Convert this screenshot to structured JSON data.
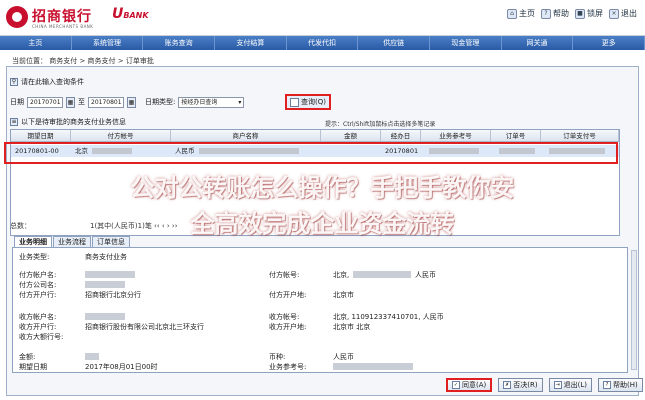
{
  "header": {
    "bank_name": "招商银行",
    "bank_name_en": "CHINA MERCHANTS BANK",
    "ubank": "U",
    "ubank_sub": "BANK",
    "links": [
      {
        "icon": "home-icon",
        "label": "主页"
      },
      {
        "icon": "help-icon",
        "label": "帮助"
      },
      {
        "icon": "lock-icon",
        "label": "锁屏"
      },
      {
        "icon": "exit-icon",
        "label": "退出"
      }
    ]
  },
  "nav": [
    "主页",
    "系统管理",
    "账务查询",
    "支付结算",
    "代发代扣",
    "供应链",
    "现金管理",
    "网关通",
    "更多"
  ],
  "breadcrumb": "当前位置： 商务支付 > 商务支付 > 订单审批",
  "query": {
    "hint": "请在此输入查询条件",
    "date_label": "日期",
    "date_from": "20170701",
    "date_to_label": "至",
    "date_to": "20170801",
    "date_type_label": "日期类型:",
    "date_type_value": "按经办日查询",
    "query_button": "查询(Q)"
  },
  "list": {
    "caption": "以下是待审批的商务支付业务信息",
    "hint": "提示：Ctrl/Shift加鼠标点击选择多笔记录",
    "columns": [
      "期望日期",
      "付方帐号",
      "商户名称",
      "金额",
      "经办日",
      "业务参考号",
      "订单号",
      "订单支付号"
    ],
    "row": {
      "date": "20170801-00",
      "payer": "北京",
      "currency": "人民币",
      "op_date": "20170801"
    },
    "footer": "总数：",
    "pager": "1(其中(人民币)1)笔   ‹‹   ‹   ›   ››"
  },
  "tabs": [
    "业务明细",
    "业务流程",
    "订单信息"
  ],
  "detail": {
    "business_type_label": "业务类型:",
    "business_type": "商务支付业务",
    "payer_account_label": "付方帐户名:",
    "payer_company_label": "付方公司名:",
    "payer_bank_label": "付方开户行:",
    "payer_bank": "招商银行北京分行",
    "payer_acct_no_label": "付方帐号:",
    "payer_acct_no_prefix": "北京,",
    "payer_currency": "人民币",
    "payer_open_place_label": "付方开户地:",
    "payer_open_place": "北京市",
    "payee_account_label": "收方帐户名:",
    "payee_bank_label": "收方开户行:",
    "payee_bank": "招商银行股份有限公司北京北三环支行",
    "payee_bank_no_label": "收方大额行号:",
    "payee_acct_no_label": "收方帐号:",
    "payee_acct_no": "北京, 110912337410701, 人民币",
    "payee_open_place_label": "收方开户地:",
    "payee_open_place": "北京市 北京",
    "amount_label": "金额:",
    "expect_date_label": "期望日期",
    "expect_date": "2017年08月01日00时",
    "currency_label": "币种:",
    "currency": "人民币",
    "ref_label": "业务参考号:"
  },
  "actions": [
    {
      "icon": "approve-icon",
      "label": "同意(A)"
    },
    {
      "icon": "reject-icon",
      "label": "否决(R)"
    },
    {
      "icon": "exit-icon",
      "label": "退出(L)"
    },
    {
      "icon": "help-icon",
      "label": "帮助(H)"
    }
  ],
  "watermark": {
    "line1": "公对公转账怎么操作？手把手教你安",
    "line2": "全高效完成企业资金流转"
  },
  "colors": {
    "brand": "#c8102e",
    "nav": "#2a5aa5",
    "highlight": "#e02020"
  }
}
